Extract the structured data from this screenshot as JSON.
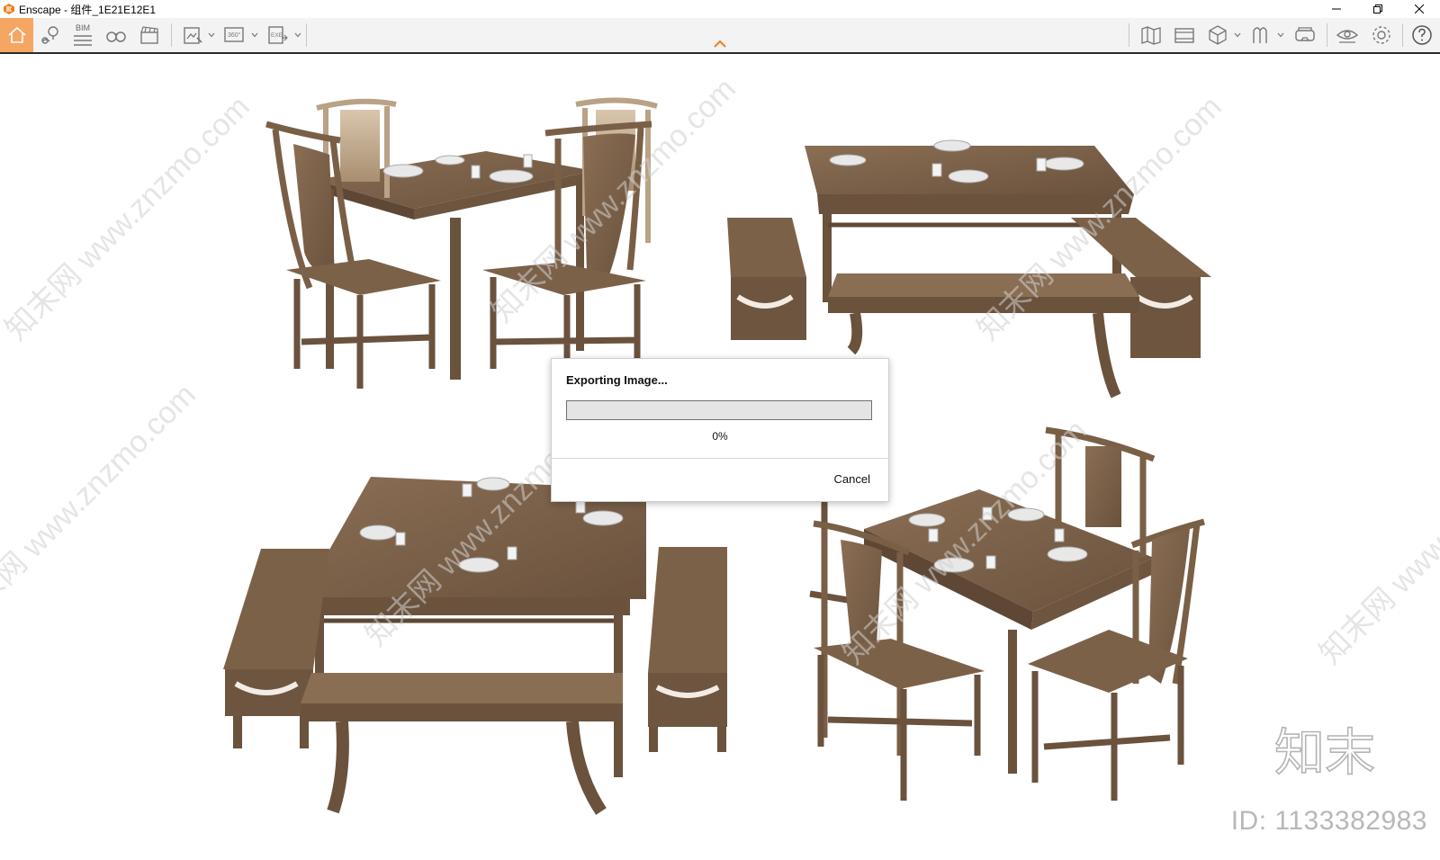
{
  "window": {
    "title": "Enscape - 组件_1E21E12E1"
  },
  "toolbar": {
    "bim_label": "BIM",
    "panorama_label": "360°",
    "exe_label": "EXE"
  },
  "colors": {
    "home_button_bg": "#f6a663",
    "collapse_chevron": "#f07d1a",
    "wood": "#7a5f47"
  },
  "icons": [
    "home-icon",
    "views-pin-icon",
    "bim-icon",
    "binoculars-icon",
    "clapper-icon",
    "screenshot-icon",
    "panorama-icon",
    "exe-icon",
    "map-icon",
    "video-editor-icon",
    "cube-icon",
    "asset-library-icon",
    "vr-headset-icon",
    "visual-settings-eye-icon",
    "settings-gear-icon",
    "help-icon"
  ],
  "dialog": {
    "title": "Exporting Image...",
    "progress": 0,
    "progress_text": "0%",
    "cancel_label": "Cancel"
  },
  "watermark": {
    "brand": "知末",
    "id_text": "ID: 1133382983",
    "diagonal_text": "知末网 www.znzmo.com"
  }
}
